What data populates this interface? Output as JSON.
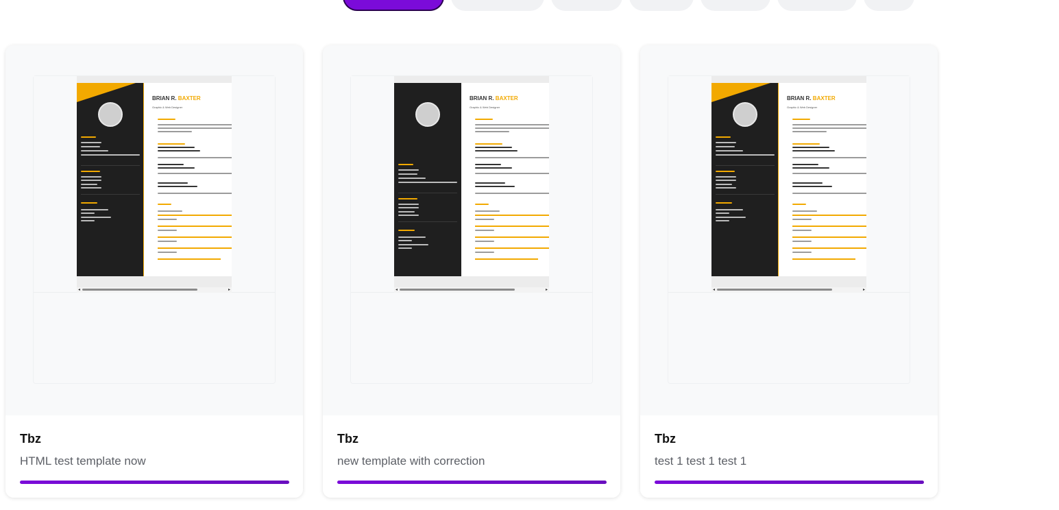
{
  "filters": {
    "pills": [
      {
        "width": 148,
        "active": true
      },
      {
        "width": 136,
        "active": false
      },
      {
        "width": 104,
        "active": false
      },
      {
        "width": 94,
        "active": false
      },
      {
        "width": 102,
        "active": false
      },
      {
        "width": 116,
        "active": false
      },
      {
        "width": 74,
        "active": false
      }
    ]
  },
  "resume_preview": {
    "first_name": "BRIAN R.",
    "last_name": "BAXTER",
    "subtitle": "Graphic & Web Designer",
    "accent_color": "#f2a900",
    "sidebar_color": "#1f1f1f"
  },
  "colors": {
    "brand": "#7b0bd9",
    "accent": "#f2a900"
  },
  "templates": [
    {
      "title": "Tbz",
      "description": "HTML test template now",
      "progress": 1.0,
      "variant": "corner"
    },
    {
      "title": "Tbz",
      "description": "new template with correction",
      "progress": 1.0,
      "variant": "plain"
    },
    {
      "title": "Tbz",
      "description": "test 1 test 1 test 1",
      "progress": 1.0,
      "variant": "corner"
    }
  ]
}
